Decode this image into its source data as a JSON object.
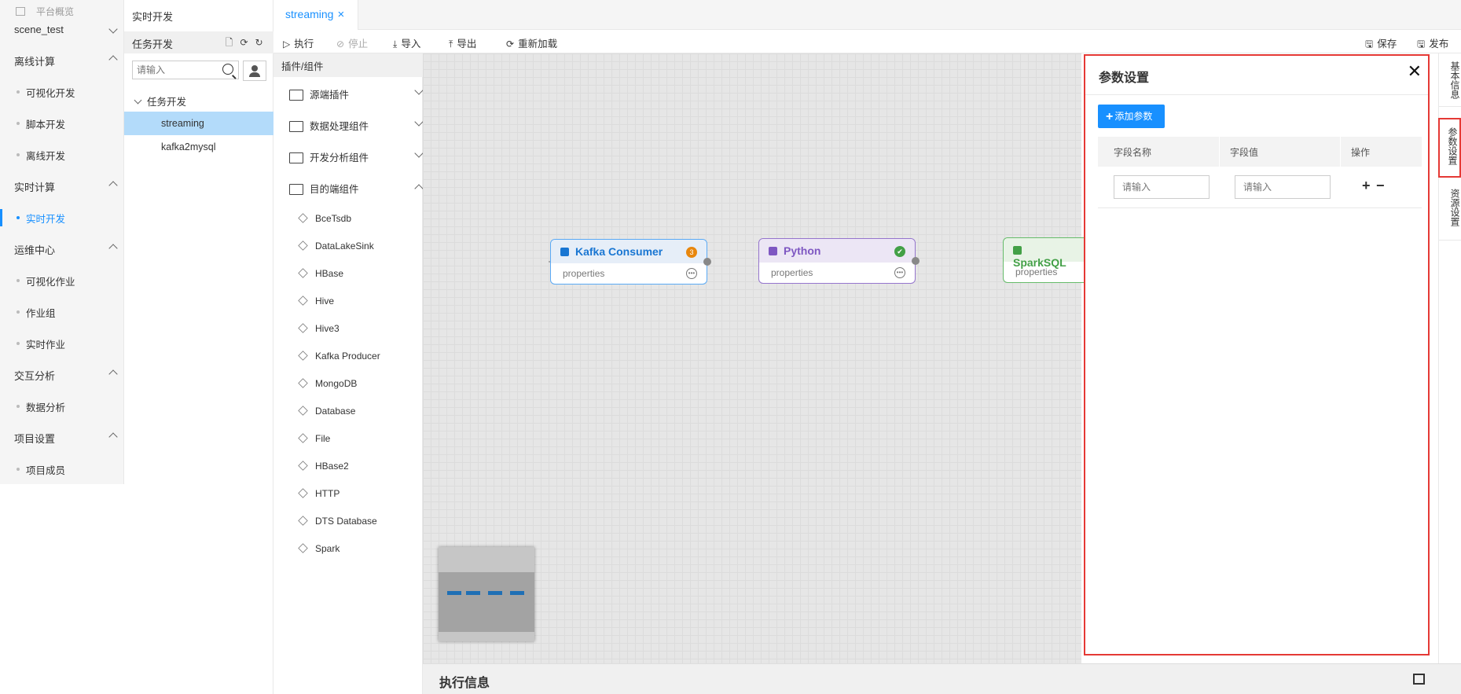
{
  "nav": {
    "top_link": "平台概览",
    "project": "scene_test",
    "sections": [
      {
        "label": "离线计算",
        "items": [
          "可视化开发",
          "脚本开发",
          "离线开发"
        ]
      },
      {
        "label": "实时计算",
        "items": [
          "实时开发"
        ]
      },
      {
        "label": "运维中心",
        "items": [
          "可视化作业",
          "作业组",
          "实时作业"
        ]
      },
      {
        "label": "交互分析",
        "items": [
          "数据分析"
        ]
      },
      {
        "label": "项目设置",
        "items": [
          "项目成员"
        ]
      }
    ],
    "active_item": "实时开发"
  },
  "tree": {
    "title": "实时开发",
    "header": "任务开发",
    "search_placeholder": "请输入",
    "folder": "任务开发",
    "items": [
      "streaming",
      "kafka2mysql"
    ],
    "selected": "streaming"
  },
  "tabs": [
    {
      "label": "streaming",
      "close": "×"
    }
  ],
  "toolbar": {
    "run": "执行",
    "stop": "停止",
    "import": "导入",
    "export": "导出",
    "reload": "重新加载",
    "save": "保存",
    "publish": "发布"
  },
  "plugins": {
    "title": "插件/组件",
    "groups": [
      "源端插件",
      "数据处理组件",
      "开发分析组件",
      "目的端组件"
    ],
    "components": [
      "BceTsdb",
      "DataLakeSink",
      "HBase",
      "Hive",
      "Hive3",
      "Kafka Producer",
      "MongoDB",
      "Database",
      "File",
      "HBase2",
      "HTTP",
      "DTS Database",
      "Spark"
    ]
  },
  "nodes": [
    {
      "title": "Kafka Consumer",
      "sub": "properties",
      "badge": "3",
      "color": "#1890ff",
      "badge_color": "#e8870e"
    },
    {
      "title": "Python",
      "sub": "properties",
      "badge": "✔",
      "color": "#7e57c2",
      "badge_color": "#43a047"
    },
    {
      "title": "SparkSQL",
      "sub": "properties",
      "color": "#43a047"
    }
  ],
  "exec_info": {
    "title": "执行信息"
  },
  "params": {
    "title": "参数设置",
    "close": "✕",
    "add_button": "添加参数",
    "columns": [
      "字段名称",
      "字段值",
      "操作"
    ],
    "row": {
      "name_placeholder": "请输入",
      "value_placeholder": "请输入",
      "add": "+",
      "remove": "−"
    }
  },
  "side_tabs": [
    "基本信息",
    "参数设置",
    "资源设置"
  ]
}
